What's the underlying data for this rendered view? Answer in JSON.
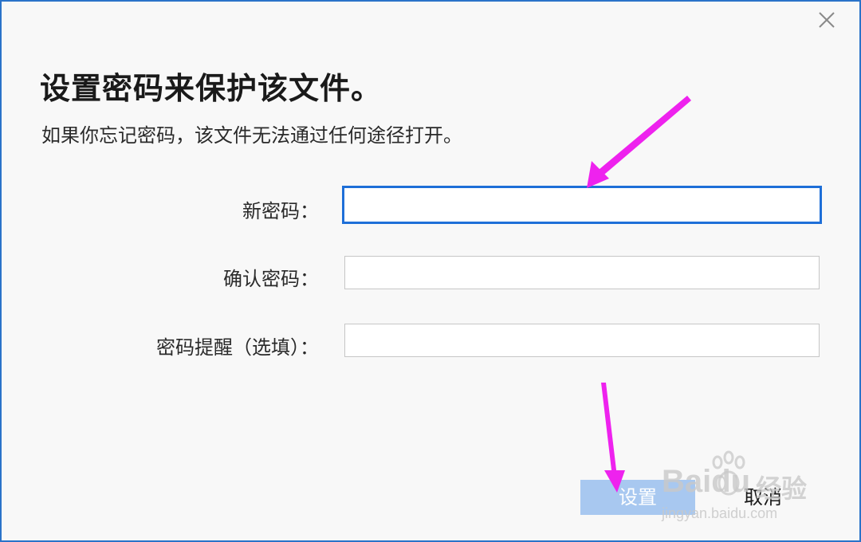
{
  "dialog": {
    "title": "设置密码来保护该文件。",
    "subtitle": "如果你忘记密码，该文件无法通过任何途径打开。"
  },
  "form": {
    "new_password": {
      "label": "新密码：",
      "value": ""
    },
    "confirm_password": {
      "label": "确认密码：",
      "value": ""
    },
    "hint": {
      "label": "密码提醒（选填）：",
      "value": ""
    }
  },
  "buttons": {
    "set_label": "设置",
    "cancel_label": "取消"
  },
  "watermark": {
    "brand": "Baidu",
    "suffix": "经验",
    "url": "jingyan.baidu.com"
  },
  "colors": {
    "accent": "#1e6fd8",
    "primary_disabled": "#a8c8f0",
    "annotation_arrow": "#ee22ee"
  },
  "icons": {
    "close": "close-icon",
    "watermark_logo": "paw-icon"
  }
}
